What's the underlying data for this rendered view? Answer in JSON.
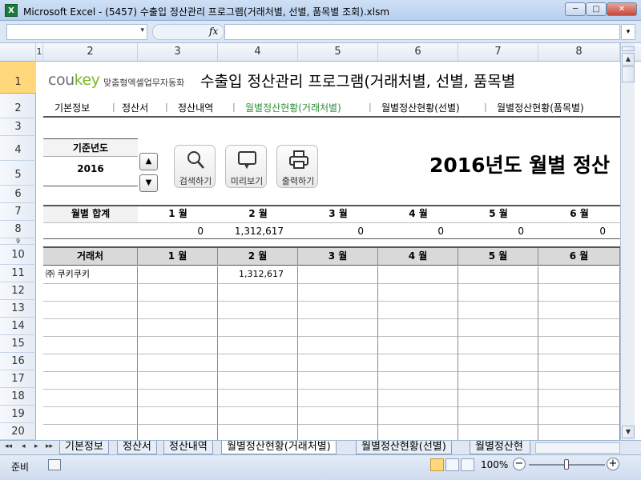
{
  "window": {
    "title": "Microsoft Excel - (5457) 수출입 정산관리 프로그램(거래처별, 선별, 품목별 조회).xlsm",
    "app_icon": "X",
    "min": "─",
    "max": "□",
    "close": "✕"
  },
  "formula": {
    "name": "",
    "fx": "fx",
    "value": ""
  },
  "columns": [
    "1",
    "2",
    "3",
    "4",
    "5",
    "6",
    "7",
    "8"
  ],
  "rows": [
    "1",
    "2",
    "3",
    "4",
    "5",
    "6",
    "7",
    "8",
    "9",
    "10",
    "11",
    "12",
    "13",
    "14",
    "15",
    "16",
    "17",
    "18",
    "19",
    "20"
  ],
  "header": {
    "logo_a": "cou",
    "logo_b": "key",
    "logo_sub": "맞춤형엑셀업무자동화",
    "title": "수출입 정산관리 프로그램(거래처별, 선별, 품목별"
  },
  "nav": [
    "기본정보",
    "정산서",
    "정산내역",
    "월별정산현황(거래처별)",
    "월별정산현황(선별)",
    "월별정산현황(품목별)"
  ],
  "year": {
    "label": "기준년도",
    "value": "2016",
    "up": "▲",
    "down": "▼"
  },
  "buttons": {
    "search": "검색하기",
    "preview": "미리보기",
    "print": "출력하기"
  },
  "big_title": "2016년도 월별 정산",
  "summary": {
    "label": "월별 합계",
    "months": [
      "1 월",
      "2 월",
      "3 월",
      "4 월",
      "5 월",
      "6 월"
    ],
    "values": [
      "0",
      "1,312,617",
      "0",
      "0",
      "0",
      "0"
    ]
  },
  "detail": {
    "headers": [
      "거래처",
      "1 월",
      "2 월",
      "3 월",
      "4 월",
      "5 월",
      "6 월"
    ],
    "rows": [
      [
        "㈜ 쿠키쿠키",
        "",
        "1,312,617",
        "",
        "",
        "",
        ""
      ]
    ]
  },
  "tabs": [
    "기본정보",
    "정산서",
    "정산내역",
    "월별정산현황(거래처별)",
    "월별정산현황(선별)",
    "월별정산현"
  ],
  "tabnav": [
    "◂◂",
    "◂",
    "▸",
    "▸▸"
  ],
  "status": {
    "ready": "준비",
    "zoom": "100%",
    "minus": "−",
    "plus": "+"
  },
  "colors": {
    "active_nav": "#2f8f3a",
    "logo_green": "#7ab82a",
    "header_fill": "#d9d9d9"
  }
}
